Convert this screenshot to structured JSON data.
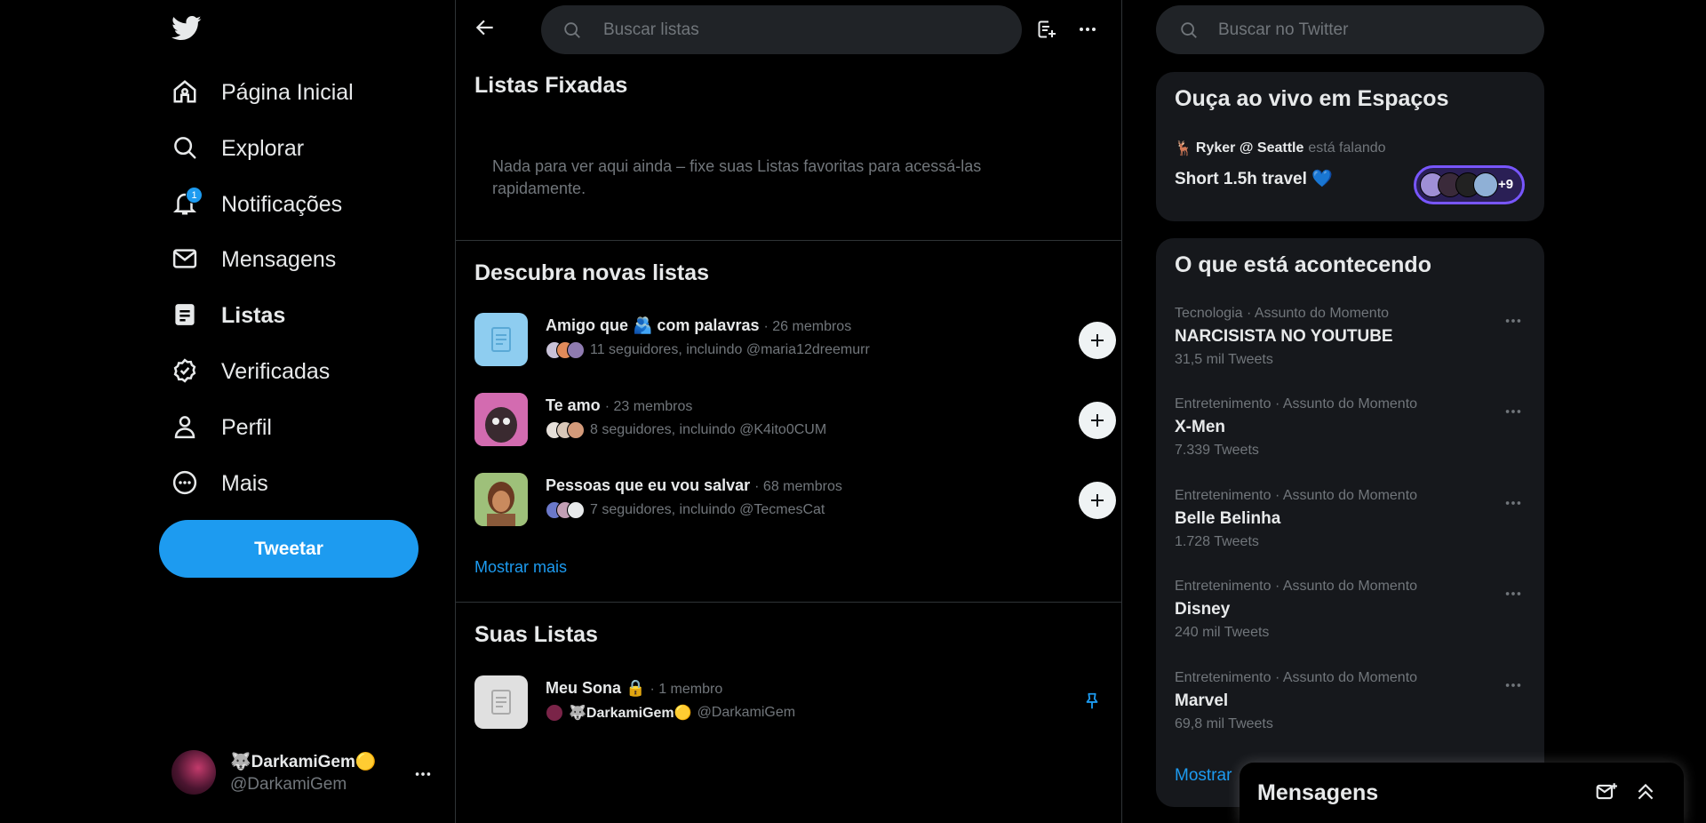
{
  "sidebar": {
    "logo_icon": "twitter-bird-icon",
    "nav": [
      {
        "label": "Página Inicial",
        "icon": "home-icon"
      },
      {
        "label": "Explorar",
        "icon": "search-icon"
      },
      {
        "label": "Notificações",
        "icon": "bell-icon",
        "badge": "1"
      },
      {
        "label": "Mensagens",
        "icon": "envelope-icon"
      },
      {
        "label": "Listas",
        "icon": "lists-icon",
        "active": true
      },
      {
        "label": "Verificadas",
        "icon": "verified-badge-icon"
      },
      {
        "label": "Perfil",
        "icon": "person-icon"
      },
      {
        "label": "Mais",
        "icon": "more-circle-icon"
      }
    ],
    "tweet_label": "Tweetar",
    "account": {
      "name": "🐺DarkamiGem🟡",
      "handle": "@DarkamiGem"
    }
  },
  "main": {
    "search_placeholder": "Buscar listas",
    "pinned": {
      "title": "Listas Fixadas",
      "empty_text": "Nada para ver aqui ainda – fixe suas Listas favoritas para acessá-las rapidamente."
    },
    "discover": {
      "title": "Descubra novas listas",
      "lists": [
        {
          "name": "Amigo que 🫂 com palavras",
          "meta": "· 26 membros",
          "followers": "11 seguidores, incluindo @maria12dreemurr",
          "thumb_color": "#8ecdf0"
        },
        {
          "name": "Te amo",
          "meta": "· 23 membros",
          "followers": "8 seguidores, incluindo @K4ito0CUM",
          "thumb_color": "#d36bb0"
        },
        {
          "name": "Pessoas que eu vou salvar",
          "meta": "· 68 membros",
          "followers": "7 seguidores, incluindo @TecmesCat",
          "thumb_color": "#8a5a3a"
        }
      ],
      "show_more": "Mostrar mais"
    },
    "yours": {
      "title": "Suas Listas",
      "lists": [
        {
          "name": "Meu Sona 🔒",
          "meta": "· 1 membro",
          "owner_name": "🐺DarkamiGem🟡",
          "owner_handle": "@DarkamiGem"
        }
      ]
    }
  },
  "right": {
    "search_placeholder": "Buscar no Twitter",
    "spaces": {
      "title": "Ouça ao vivo em Espaços",
      "host_emoji": "🦌",
      "host": "Ryker @ Seattle",
      "host_status": "está falando",
      "space_title": "Short 1.5h travel 💙",
      "listeners_extra": "+9"
    },
    "trends": {
      "title": "O que está acontecendo",
      "items": [
        {
          "context": "Tecnologia · Assunto do Momento",
          "name": "NARCISISTA NO YOUTUBE",
          "count": "31,5 mil Tweets"
        },
        {
          "context": "Entretenimento · Assunto do Momento",
          "name": "X-Men",
          "count": "7.339 Tweets"
        },
        {
          "context": "Entretenimento · Assunto do Momento",
          "name": "Belle Belinha",
          "count": "1.728 Tweets"
        },
        {
          "context": "Entretenimento · Assunto do Momento",
          "name": "Disney",
          "count": "240 mil Tweets"
        },
        {
          "context": "Entretenimento · Assunto do Momento",
          "name": "Marvel",
          "count": "69,8 mil Tweets"
        }
      ],
      "show_more": "Mostrar"
    }
  },
  "messages_drawer": {
    "title": "Mensagens"
  },
  "colors": {
    "accent": "#1d9bf0",
    "background": "#000000",
    "card": "#16181c",
    "muted": "#71767b",
    "spaces_purple": "#7856ff"
  }
}
